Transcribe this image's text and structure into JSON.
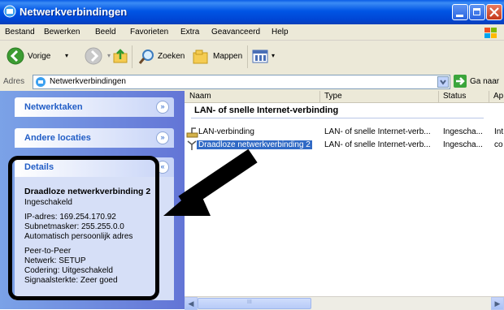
{
  "window": {
    "title": "Netwerkverbindingen"
  },
  "menubar": {
    "items": [
      "Bestand",
      "Bewerken",
      "Beeld",
      "Favorieten",
      "Extra",
      "Geavanceerd",
      "Help"
    ]
  },
  "toolbar": {
    "back_label": "Vorige",
    "search_label": "Zoeken",
    "folders_label": "Mappen"
  },
  "addressbar": {
    "label": "Adres",
    "value": "Netwerkverbindingen",
    "go_label": "Ga naar"
  },
  "taskpane": {
    "network_tasks": "Netwerktaken",
    "other_places": "Andere locaties",
    "details": {
      "heading": "Details",
      "name": "Draadloze netwerkverbinding 2",
      "status": "Ingeschakeld",
      "ip": "IP-adres: 169.254.170.92",
      "subnet": "Subnetmasker: 255.255.0.0",
      "auto_addr": "Automatisch persoonlijk adres",
      "mode": "Peer-to-Peer",
      "network": "Netwerk: SETUP",
      "encryption": "Codering: Uitgeschakeld",
      "signal": "Signaalsterkte: Zeer goed"
    }
  },
  "list": {
    "columns": [
      "Naam",
      "Type",
      "Status",
      "Ap"
    ],
    "group_title": "LAN- of snelle Internet-verbinding",
    "rows": [
      {
        "name": "LAN-verbinding",
        "type": "LAN- of snelle Internet-verb...",
        "status": "Ingescha...",
        "extra": "Int"
      },
      {
        "name": "Draadloze netwerkverbinding 2",
        "type": "LAN- of snelle Internet-verb...",
        "status": "Ingescha...",
        "extra": "co"
      }
    ]
  },
  "scrollbar": {
    "thumb_grip": "III"
  }
}
